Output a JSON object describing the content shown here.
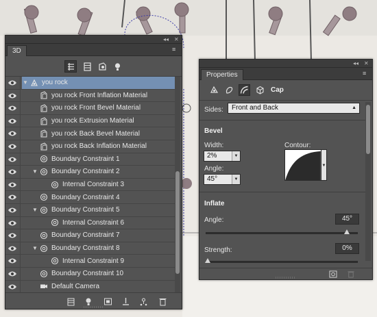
{
  "colors": {
    "panel_bg": "#535353",
    "panel_dark": "#3c3c3c",
    "selection": "#7490b3",
    "canvas": "#ece9e4"
  },
  "panel_3d": {
    "tab_label": "3D",
    "filter_icons": [
      "scene-filter-icon",
      "mesh-filter-icon",
      "material-filter-icon",
      "light-filter-icon"
    ],
    "rows": [
      {
        "label": "you rock",
        "icon": "scene-object-icon",
        "indent": 0,
        "twisty": "▼",
        "selected": true
      },
      {
        "label": "you rock Front Inflation Material",
        "icon": "material-icon",
        "indent": 1,
        "twisty": "",
        "selected": false
      },
      {
        "label": "you rock Front Bevel Material",
        "icon": "material-icon",
        "indent": 1,
        "twisty": "",
        "selected": false
      },
      {
        "label": "you rock Extrusion Material",
        "icon": "material-icon",
        "indent": 1,
        "twisty": "",
        "selected": false
      },
      {
        "label": "you rock Back Bevel Material",
        "icon": "material-icon",
        "indent": 1,
        "twisty": "",
        "selected": false
      },
      {
        "label": "you rock Back Inflation Material",
        "icon": "material-icon",
        "indent": 1,
        "twisty": "",
        "selected": false
      },
      {
        "label": "Boundary Constraint 1",
        "icon": "constraint-icon",
        "indent": 1,
        "twisty": "",
        "selected": false
      },
      {
        "label": "Boundary Constraint 2",
        "icon": "constraint-icon",
        "indent": 1,
        "twisty": "▼",
        "selected": false
      },
      {
        "label": "Internal Constraint 3",
        "icon": "constraint-icon",
        "indent": 2,
        "twisty": "",
        "selected": false
      },
      {
        "label": "Boundary Constraint 4",
        "icon": "constraint-icon",
        "indent": 1,
        "twisty": "",
        "selected": false
      },
      {
        "label": "Boundary Constraint 5",
        "icon": "constraint-icon",
        "indent": 1,
        "twisty": "▼",
        "selected": false
      },
      {
        "label": "Internal Constraint 6",
        "icon": "constraint-icon",
        "indent": 2,
        "twisty": "",
        "selected": false
      },
      {
        "label": "Boundary Constraint 7",
        "icon": "constraint-icon",
        "indent": 1,
        "twisty": "",
        "selected": false
      },
      {
        "label": "Boundary Constraint 8",
        "icon": "constraint-icon",
        "indent": 1,
        "twisty": "▼",
        "selected": false
      },
      {
        "label": "Internal Constraint 9",
        "icon": "constraint-icon",
        "indent": 2,
        "twisty": "",
        "selected": false
      },
      {
        "label": "Boundary Constraint 10",
        "icon": "constraint-icon",
        "indent": 1,
        "twisty": "",
        "selected": false
      },
      {
        "label": "Default Camera",
        "icon": "camera-icon",
        "indent": 0,
        "twisty": "",
        "selected": false
      }
    ],
    "bottom_icons": [
      "render-settings-icon",
      "add-light-icon",
      "add-mesh-icon",
      "move-to-ground-icon",
      "add-constraint-icon",
      "delete-icon"
    ]
  },
  "properties": {
    "tab_label": "Properties",
    "cap_label": "Cap",
    "sides_label": "Sides:",
    "sides_value": "Front and Back",
    "bevel_title": "Bevel",
    "width_label": "Width:",
    "width_value": "2%",
    "contour_label": "Contour:",
    "angle_label": "Angle:",
    "angle_value": "45°",
    "inflate_title": "Inflate",
    "inflate_angle_label": "Angle:",
    "inflate_angle_value": "45°",
    "inflate_angle_fraction": 0.93,
    "strength_label": "Strength:",
    "strength_value": "0%",
    "strength_fraction": 0.0
  }
}
